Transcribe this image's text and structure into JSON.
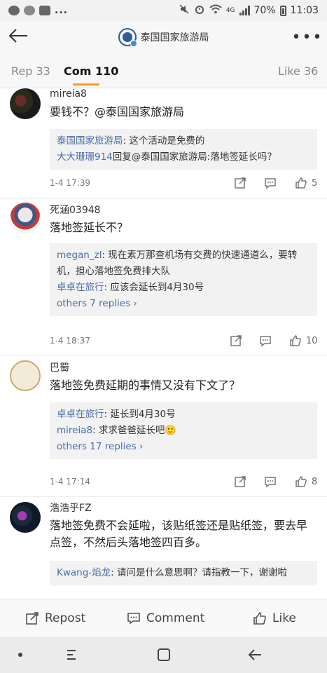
{
  "status_bar": {
    "left_icons": [
      "weibo-icon",
      "line-icon",
      "image-icon"
    ],
    "more": "...",
    "network": "4G",
    "battery": "70%",
    "time": "11:03"
  },
  "header": {
    "title": "泰国国家旅游局",
    "more_label": "•••"
  },
  "tabs": {
    "repost": "Rep 33",
    "comment": "Com 110",
    "like": "Like 36",
    "active": "comment"
  },
  "comments": [
    {
      "user": "mireia8",
      "text": "要钱不？@泰国国家旅游局",
      "replies": [
        {
          "user": "泰国国家旅游局",
          "text": ": 这个活动是免费的"
        },
        {
          "user": "大大珊珊914",
          "text": "回复@泰国国家旅游局:落地签延长吗？"
        }
      ],
      "more_replies": "",
      "time": "1-4 17:39",
      "likes": "5"
    },
    {
      "user": "死涵03948",
      "text": "落地签延长不？",
      "replies": [
        {
          "user": "megan_zl",
          "text": ": 现在素万那查机场有交费的快速通道么，要转机，担心落地签免费排大队"
        },
        {
          "user": "卓卓在旅行",
          "text": ": 应该会延长到4月30号"
        }
      ],
      "more_replies": "others 7 replies ›",
      "time": "1-4 18:37",
      "likes": "10"
    },
    {
      "user": "巴蜀",
      "text": "落地签免费延期的事情又没有下文了？",
      "replies": [
        {
          "user": "卓卓在旅行",
          "text": ": 延长到4月30号"
        },
        {
          "user": "mireia8",
          "text": ": 求求爸爸延长吧🙂"
        }
      ],
      "more_replies": "others 17 replies ›",
      "time": "1-4 17:14",
      "likes": "8"
    },
    {
      "user": "浩浩乎FZ",
      "text": "落地签免费不会延啦，该贴纸签还是贴纸签，要去早点签，不然后头落地签四百多。",
      "replies": [
        {
          "user": "Kwang-焰龙",
          "text": ": 请问是什么意思啊？请指教一下，谢谢啦"
        }
      ],
      "more_replies": "",
      "time": "",
      "likes": ""
    }
  ],
  "bottom_bar": {
    "repost": "Repost",
    "comment": "Comment",
    "like": "Like"
  },
  "colors": {
    "link_blue": "#4a6da7",
    "tab_accent": "#f59a23",
    "reply_bg": "#f2f2f2"
  }
}
